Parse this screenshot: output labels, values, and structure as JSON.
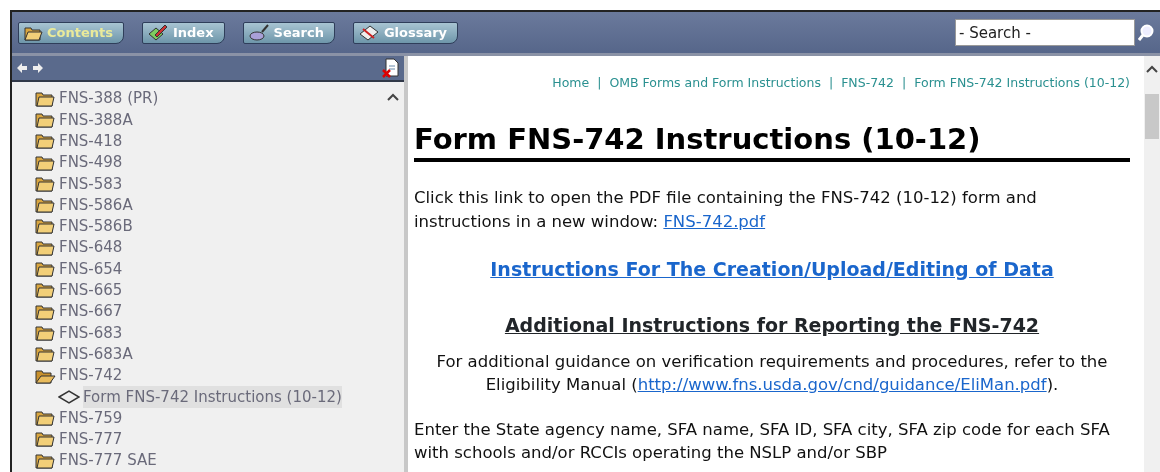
{
  "tabs": [
    {
      "label": "Contents",
      "selected": true
    },
    {
      "label": "Index",
      "selected": false
    },
    {
      "label": "Search",
      "selected": false
    },
    {
      "label": "Glossary",
      "selected": false
    }
  ],
  "search": {
    "placeholder": "- Search -"
  },
  "tree": [
    {
      "label": "FNS-388 (PR)",
      "expanded": false
    },
    {
      "label": "FNS-388A",
      "expanded": false
    },
    {
      "label": "FNS-418",
      "expanded": false
    },
    {
      "label": "FNS-498",
      "expanded": false
    },
    {
      "label": "FNS-583",
      "expanded": false
    },
    {
      "label": "FNS-586A",
      "expanded": false
    },
    {
      "label": "FNS-586B",
      "expanded": false
    },
    {
      "label": "FNS-648",
      "expanded": false
    },
    {
      "label": "FNS-654",
      "expanded": false
    },
    {
      "label": "FNS-665",
      "expanded": false
    },
    {
      "label": "FNS-667",
      "expanded": false
    },
    {
      "label": "FNS-683",
      "expanded": false
    },
    {
      "label": "FNS-683A",
      "expanded": false
    },
    {
      "label": "FNS-742",
      "expanded": true,
      "children": [
        {
          "label": "Form FNS-742 Instructions (10-12)",
          "selected": true
        }
      ]
    },
    {
      "label": "FNS-759",
      "expanded": false
    },
    {
      "label": "FNS-777",
      "expanded": false
    },
    {
      "label": "FNS-777 SAE",
      "expanded": false
    }
  ],
  "breadcrumbs": {
    "links": [
      "Home",
      "OMB Forms and Form Instructions",
      "FNS-742",
      "Form FNS-742 Instructions (10-12)"
    ],
    "separator": "|"
  },
  "title": "Form FNS-742 Instructions (10-12)",
  "content": [
    {
      "kind": "paragraph",
      "text": "Click this link to open the PDF file containing the FNS-742 (10-12) form and instructions in a new window: ",
      "link": "FNS-742.pdf"
    },
    {
      "kind": "link_heading",
      "text": "Instructions For The Creation/Upload/Editing of Data"
    },
    {
      "kind": "heading",
      "text": "Additional Instructions for Reporting the FNS-742"
    },
    {
      "kind": "centered",
      "text": "For additional guidance on verification requirements and procedures, refer to the Eligibility Manual (",
      "link": "http://www.fns.usda.gov/cnd/guidance/EliMan.pdf",
      "after": ")."
    },
    {
      "kind": "paragraph",
      "text": "Enter the State agency name, SFA name, SFA ID, SFA city, SFA zip code for each SFA with schools and/or RCCIs operating the NSLP and/or SBP"
    }
  ]
}
